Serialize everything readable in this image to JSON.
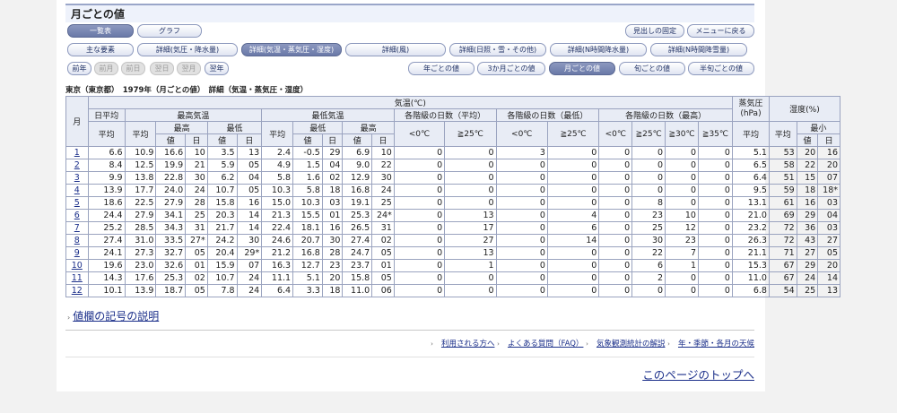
{
  "header": {
    "title": "月ごとの値"
  },
  "top_buttons": {
    "list": "一覧表",
    "graph": "グラフ",
    "fixed_heading": "見出しの固定",
    "back_menu": "メニューに戻る"
  },
  "element_tabs": [
    "主な要素",
    "詳細(気圧・降水量)",
    "詳細(気温・蒸気圧・湿度)",
    "詳細(風)",
    "詳細(日照・雪・その他)",
    "詳細(N時間降水量)",
    "詳細(N時間降雪量)"
  ],
  "nav_buttons": [
    "前年",
    "前月",
    "前日",
    "翌日",
    "翌月",
    "翌年"
  ],
  "period_tabs": [
    "年ごとの値",
    "3か月ごとの値",
    "月ごとの値",
    "旬ごとの値",
    "半旬ごとの値"
  ],
  "caption": "東京（東京都）　1979年（月ごとの値）　詳細（気温・蒸気圧・湿度）",
  "table": {
    "h_month": "月",
    "h_temp": "気温(℃)",
    "h_vapor": "蒸気圧(hPa)",
    "h_humidity": "湿度(%)",
    "h_daily_mean": "日平均",
    "h_max_temp": "最高気温",
    "h_min_temp": "最低気温",
    "h_days_mean": "各階級の日数（平均）",
    "h_days_min": "各階級の日数（最低）",
    "h_days_max": "各階級の日数（最高）",
    "h_avg": "平均",
    "h_highest": "最高",
    "h_lowest": "最低",
    "h_min_short": "最小",
    "h_val": "値",
    "h_day": "日",
    "h_lt0": "<0℃",
    "h_ge25": "≧25℃",
    "h_ge30": "≧30℃",
    "h_ge35": "≧35℃",
    "rows": [
      [
        "1",
        "6.6",
        "10.9",
        "16.6",
        "10",
        "3.5",
        "13",
        "2.4",
        "-0.5",
        "29",
        "6.9",
        "10",
        "0",
        "0",
        "3",
        "0",
        "0",
        "0",
        "0",
        "0",
        "5.1",
        "53",
        "20",
        "16"
      ],
      [
        "2",
        "8.4",
        "12.5",
        "19.9",
        "21",
        "5.9",
        "05",
        "4.9",
        "1.5",
        "04",
        "9.0",
        "22",
        "0",
        "0",
        "0",
        "0",
        "0",
        "0",
        "0",
        "0",
        "6.5",
        "58",
        "22",
        "20"
      ],
      [
        "3",
        "9.9",
        "13.8",
        "22.8",
        "30",
        "6.2",
        "04",
        "5.8",
        "1.6",
        "02",
        "12.9",
        "30",
        "0",
        "0",
        "0",
        "0",
        "0",
        "0",
        "0",
        "0",
        "6.4",
        "51",
        "15",
        "07"
      ],
      [
        "4",
        "13.9",
        "17.7",
        "24.0",
        "24",
        "10.7",
        "05",
        "10.3",
        "5.8",
        "18",
        "16.8",
        "24",
        "0",
        "0",
        "0",
        "0",
        "0",
        "0",
        "0",
        "0",
        "9.5",
        "59",
        "18",
        "18*"
      ],
      [
        "5",
        "18.6",
        "22.5",
        "27.9",
        "28",
        "15.8",
        "16",
        "15.0",
        "10.3",
        "03",
        "19.1",
        "25",
        "0",
        "0",
        "0",
        "0",
        "0",
        "8",
        "0",
        "0",
        "13.1",
        "61",
        "16",
        "03"
      ],
      [
        "6",
        "24.4",
        "27.9",
        "34.1",
        "25",
        "20.3",
        "14",
        "21.3",
        "15.5",
        "01",
        "25.3",
        "24*",
        "0",
        "13",
        "0",
        "4",
        "0",
        "23",
        "10",
        "0",
        "21.0",
        "69",
        "29",
        "04"
      ],
      [
        "7",
        "25.2",
        "28.5",
        "34.3",
        "31",
        "21.7",
        "14",
        "22.4",
        "18.1",
        "16",
        "26.5",
        "31",
        "0",
        "17",
        "0",
        "6",
        "0",
        "25",
        "12",
        "0",
        "23.2",
        "72",
        "36",
        "03"
      ],
      [
        "8",
        "27.4",
        "31.0",
        "33.5",
        "27*",
        "24.2",
        "30",
        "24.6",
        "20.7",
        "30",
        "27.4",
        "02",
        "0",
        "27",
        "0",
        "14",
        "0",
        "30",
        "23",
        "0",
        "26.3",
        "72",
        "43",
        "27"
      ],
      [
        "9",
        "24.1",
        "27.3",
        "32.7",
        "05",
        "20.4",
        "29*",
        "21.2",
        "16.8",
        "28",
        "24.7",
        "05",
        "0",
        "13",
        "0",
        "0",
        "0",
        "22",
        "7",
        "0",
        "21.1",
        "71",
        "27",
        "05"
      ],
      [
        "10",
        "19.6",
        "23.0",
        "32.6",
        "01",
        "15.9",
        "07",
        "16.3",
        "12.7",
        "23",
        "23.7",
        "01",
        "0",
        "1",
        "0",
        "0",
        "0",
        "6",
        "1",
        "0",
        "15.3",
        "67",
        "29",
        "20"
      ],
      [
        "11",
        "14.3",
        "17.6",
        "25.3",
        "02",
        "10.7",
        "24",
        "11.1",
        "5.1",
        "20",
        "15.8",
        "05",
        "0",
        "0",
        "0",
        "0",
        "0",
        "2",
        "0",
        "0",
        "11.0",
        "67",
        "24",
        "14"
      ],
      [
        "12",
        "10.1",
        "13.9",
        "18.7",
        "05",
        "7.8",
        "24",
        "6.4",
        "3.3",
        "18",
        "11.0",
        "06",
        "0",
        "0",
        "0",
        "0",
        "0",
        "0",
        "0",
        "0",
        "6.8",
        "54",
        "25",
        "13"
      ]
    ]
  },
  "legend_link": "値欄の記号の説明",
  "footer_links": [
    "利用される方へ",
    "よくある質問（FAQ）",
    "気象観測統計の解説",
    "年・季節・各月の天候"
  ],
  "top_link": "このページのトップへ"
}
